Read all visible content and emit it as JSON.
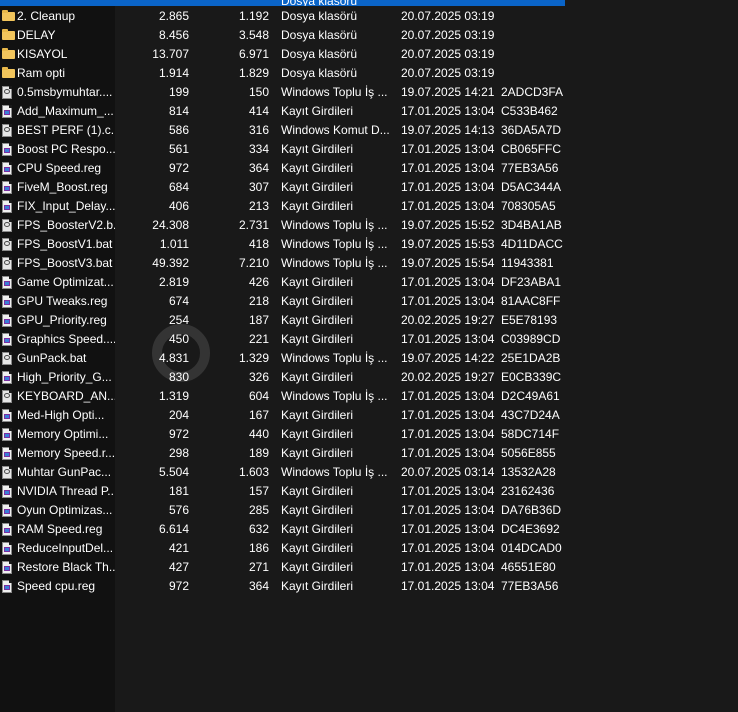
{
  "colors": {
    "background": "#191919",
    "name_column_bg": "#111111",
    "selection": "#0a64c8"
  },
  "selected_row": {
    "type": "Dosya klasörü"
  },
  "files": [
    {
      "name": "2.  Cleanup",
      "size": "2.865",
      "packed": "1.192",
      "type": "Dosya klasörü",
      "modified": "20.07.2025 03:19",
      "crc": "",
      "icon": "folder-icon"
    },
    {
      "name": "DELAY",
      "size": "8.456",
      "packed": "3.548",
      "type": "Dosya klasörü",
      "modified": "20.07.2025 03:19",
      "crc": "",
      "icon": "folder-icon"
    },
    {
      "name": "KISAYOL",
      "size": "13.707",
      "packed": "6.971",
      "type": "Dosya klasörü",
      "modified": "20.07.2025 03:19",
      "crc": "",
      "icon": "folder-icon"
    },
    {
      "name": "Ram opti",
      "size": "1.914",
      "packed": "1.829",
      "type": "Dosya klasörü",
      "modified": "20.07.2025 03:19",
      "crc": "",
      "icon": "folder-icon"
    },
    {
      "name": "0.5msbymuhtar....",
      "size": "199",
      "packed": "150",
      "type": "Windows Toplu İş ...",
      "modified": "19.07.2025 14:21",
      "crc": "2ADCD3FA",
      "icon": "batch-file-icon"
    },
    {
      "name": "Add_Maximum_...",
      "size": "814",
      "packed": "414",
      "type": "Kayıt Girdileri",
      "modified": "17.01.2025 13:04",
      "crc": "C533B462",
      "icon": "registry-file-icon"
    },
    {
      "name": "BEST PERF (1).c...",
      "size": "586",
      "packed": "316",
      "type": "Windows Komut D...",
      "modified": "19.07.2025 14:13",
      "crc": "36DA5A7D",
      "icon": "batch-file-icon"
    },
    {
      "name": "Boost PC Respo...",
      "size": "561",
      "packed": "334",
      "type": "Kayıt Girdileri",
      "modified": "17.01.2025 13:04",
      "crc": "CB065FFC",
      "icon": "registry-file-icon"
    },
    {
      "name": "CPU Speed.reg",
      "size": "972",
      "packed": "364",
      "type": "Kayıt Girdileri",
      "modified": "17.01.2025 13:04",
      "crc": "77EB3A56",
      "icon": "registry-file-icon"
    },
    {
      "name": "FiveM_Boost.reg",
      "size": "684",
      "packed": "307",
      "type": "Kayıt Girdileri",
      "modified": "17.01.2025 13:04",
      "crc": "D5AC344A",
      "icon": "registry-file-icon"
    },
    {
      "name": "FIX_Input_Delay....",
      "size": "406",
      "packed": "213",
      "type": "Kayıt Girdileri",
      "modified": "17.01.2025 13:04",
      "crc": "708305A5",
      "icon": "registry-file-icon"
    },
    {
      "name": "FPS_BoosterV2.b...",
      "size": "24.308",
      "packed": "2.731",
      "type": "Windows Toplu İş ...",
      "modified": "19.07.2025 15:52",
      "crc": "3D4BA1AB",
      "icon": "batch-file-icon"
    },
    {
      "name": "FPS_BoostV1.bat",
      "size": "1.011",
      "packed": "418",
      "type": "Windows Toplu İş ...",
      "modified": "19.07.2025 15:53",
      "crc": "4D11DACC",
      "icon": "batch-file-icon"
    },
    {
      "name": "FPS_BoostV3.bat",
      "size": "49.392",
      "packed": "7.210",
      "type": "Windows Toplu İş ...",
      "modified": "19.07.2025 15:54",
      "crc": "11943381",
      "icon": "batch-file-icon"
    },
    {
      "name": "Game Optimizat...",
      "size": "2.819",
      "packed": "426",
      "type": "Kayıt Girdileri",
      "modified": "17.01.2025 13:04",
      "crc": "DF23ABA1",
      "icon": "registry-file-icon"
    },
    {
      "name": "GPU Tweaks.reg",
      "size": "674",
      "packed": "218",
      "type": "Kayıt Girdileri",
      "modified": "17.01.2025 13:04",
      "crc": "81AAC8FF",
      "icon": "registry-file-icon"
    },
    {
      "name": "GPU_Priority.reg",
      "size": "254",
      "packed": "187",
      "type": "Kayıt Girdileri",
      "modified": "20.02.2025 19:27",
      "crc": "E5E78193",
      "icon": "registry-file-icon"
    },
    {
      "name": "Graphics Speed....",
      "size": "450",
      "packed": "221",
      "type": "Kayıt Girdileri",
      "modified": "17.01.2025 13:04",
      "crc": "C03989CD",
      "icon": "registry-file-icon"
    },
    {
      "name": "GunPack.bat",
      "size": "4.831",
      "packed": "1.329",
      "type": "Windows Toplu İş ...",
      "modified": "19.07.2025 14:22",
      "crc": "25E1DA2B",
      "icon": "batch-file-icon"
    },
    {
      "name": "High_Priority_G...",
      "size": "830",
      "packed": "326",
      "type": "Kayıt Girdileri",
      "modified": "20.02.2025 19:27",
      "crc": "E0CB339C",
      "icon": "registry-file-icon"
    },
    {
      "name": "KEYBOARD_AN...",
      "size": "1.319",
      "packed": "604",
      "type": "Windows Toplu İş ...",
      "modified": "17.01.2025 13:04",
      "crc": "D2C49A61",
      "icon": "batch-file-icon"
    },
    {
      "name": "Med-High Opti...",
      "size": "204",
      "packed": "167",
      "type": "Kayıt Girdileri",
      "modified": "17.01.2025 13:04",
      "crc": "43C7D24A",
      "icon": "registry-file-icon"
    },
    {
      "name": "Memory Optimi...",
      "size": "972",
      "packed": "440",
      "type": "Kayıt Girdileri",
      "modified": "17.01.2025 13:04",
      "crc": "58DC714F",
      "icon": "registry-file-icon"
    },
    {
      "name": "Memory Speed.r...",
      "size": "298",
      "packed": "189",
      "type": "Kayıt Girdileri",
      "modified": "17.01.2025 13:04",
      "crc": "5056E855",
      "icon": "registry-file-icon"
    },
    {
      "name": "Muhtar GunPac...",
      "size": "5.504",
      "packed": "1.603",
      "type": "Windows Toplu İş ...",
      "modified": "20.07.2025 03:14",
      "crc": "13532A28",
      "icon": "batch-file-icon"
    },
    {
      "name": "NVIDIA Thread P...",
      "size": "181",
      "packed": "157",
      "type": "Kayıt Girdileri",
      "modified": "17.01.2025 13:04",
      "crc": "23162436",
      "icon": "registry-file-icon"
    },
    {
      "name": "Oyun Optimizas...",
      "size": "576",
      "packed": "285",
      "type": "Kayıt Girdileri",
      "modified": "17.01.2025 13:04",
      "crc": "DA76B36D",
      "icon": "registry-file-icon"
    },
    {
      "name": "RAM Speed.reg",
      "size": "6.614",
      "packed": "632",
      "type": "Kayıt Girdileri",
      "modified": "17.01.2025 13:04",
      "crc": "DC4E3692",
      "icon": "registry-file-icon"
    },
    {
      "name": "ReduceInputDel...",
      "size": "421",
      "packed": "186",
      "type": "Kayıt Girdileri",
      "modified": "17.01.2025 13:04",
      "crc": "014DCAD0",
      "icon": "registry-file-icon"
    },
    {
      "name": "Restore Black Th...",
      "size": "427",
      "packed": "271",
      "type": "Kayıt Girdileri",
      "modified": "17.01.2025 13:04",
      "crc": "46551E80",
      "icon": "registry-file-icon"
    },
    {
      "name": "Speed cpu.reg",
      "size": "972",
      "packed": "364",
      "type": "Kayıt Girdileri",
      "modified": "17.01.2025 13:04",
      "crc": "77EB3A56",
      "icon": "registry-file-icon"
    }
  ]
}
